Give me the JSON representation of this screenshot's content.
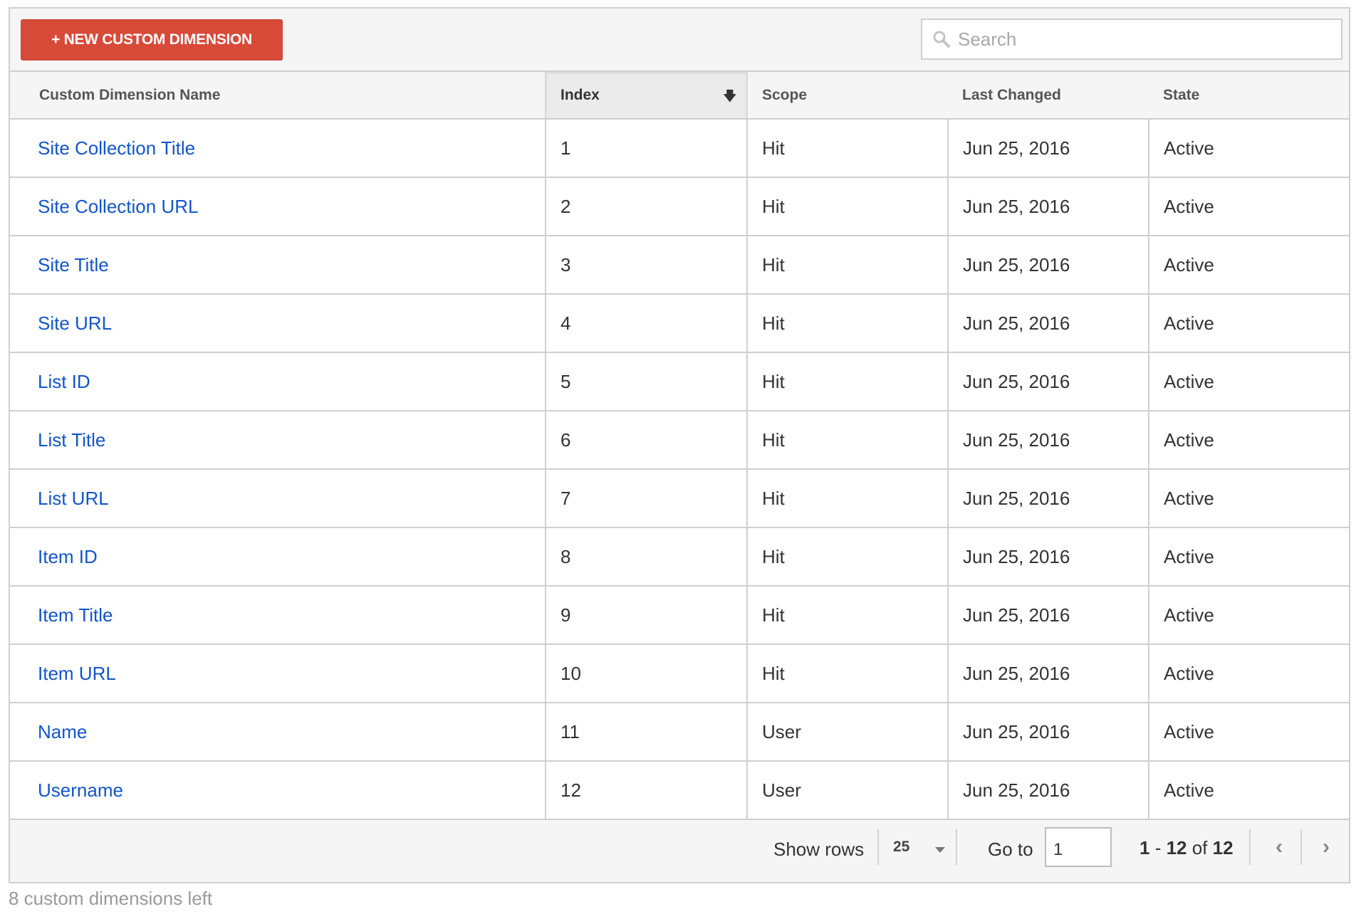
{
  "toolbar": {
    "new_button_label": "+ NEW CUSTOM DIMENSION",
    "search_placeholder": "Search",
    "search_value": ""
  },
  "colors": {
    "primary_button": "#d84a38",
    "link": "#1155cc"
  },
  "table": {
    "columns": [
      {
        "label": "Custom Dimension Name",
        "sorted": false
      },
      {
        "label": "Index",
        "sorted": true,
        "sort_direction": "descending-arrow"
      },
      {
        "label": "Scope",
        "sorted": false
      },
      {
        "label": "Last Changed",
        "sorted": false
      },
      {
        "label": "State",
        "sorted": false
      }
    ],
    "sort_icon": "arrow-down-icon",
    "rows": [
      {
        "name": "Site Collection Title",
        "index": "1",
        "scope": "Hit",
        "last_changed": "Jun 25, 2016",
        "state": "Active"
      },
      {
        "name": "Site Collection URL",
        "index": "2",
        "scope": "Hit",
        "last_changed": "Jun 25, 2016",
        "state": "Active"
      },
      {
        "name": "Site Title",
        "index": "3",
        "scope": "Hit",
        "last_changed": "Jun 25, 2016",
        "state": "Active"
      },
      {
        "name": "Site URL",
        "index": "4",
        "scope": "Hit",
        "last_changed": "Jun 25, 2016",
        "state": "Active"
      },
      {
        "name": "List ID",
        "index": "5",
        "scope": "Hit",
        "last_changed": "Jun 25, 2016",
        "state": "Active"
      },
      {
        "name": "List Title",
        "index": "6",
        "scope": "Hit",
        "last_changed": "Jun 25, 2016",
        "state": "Active"
      },
      {
        "name": "List URL",
        "index": "7",
        "scope": "Hit",
        "last_changed": "Jun 25, 2016",
        "state": "Active"
      },
      {
        "name": "Item ID",
        "index": "8",
        "scope": "Hit",
        "last_changed": "Jun 25, 2016",
        "state": "Active"
      },
      {
        "name": "Item Title",
        "index": "9",
        "scope": "Hit",
        "last_changed": "Jun 25, 2016",
        "state": "Active"
      },
      {
        "name": "Item URL",
        "index": "10",
        "scope": "Hit",
        "last_changed": "Jun 25, 2016",
        "state": "Active"
      },
      {
        "name": "Name",
        "index": "11",
        "scope": "User",
        "last_changed": "Jun 25, 2016",
        "state": "Active"
      },
      {
        "name": "Username",
        "index": "12",
        "scope": "User",
        "last_changed": "Jun 25, 2016",
        "state": "Active"
      }
    ]
  },
  "pagination": {
    "show_rows_label": "Show rows",
    "rows_per_page": "25",
    "goto_label": "Go to",
    "goto_value": "1",
    "range_start": "1",
    "range_sep": " - ",
    "range_end": "12",
    "of_label": " of ",
    "total": "12",
    "prev_icon": "chevron-left-icon",
    "next_icon": "chevron-right-icon"
  },
  "note": "8 custom dimensions left"
}
